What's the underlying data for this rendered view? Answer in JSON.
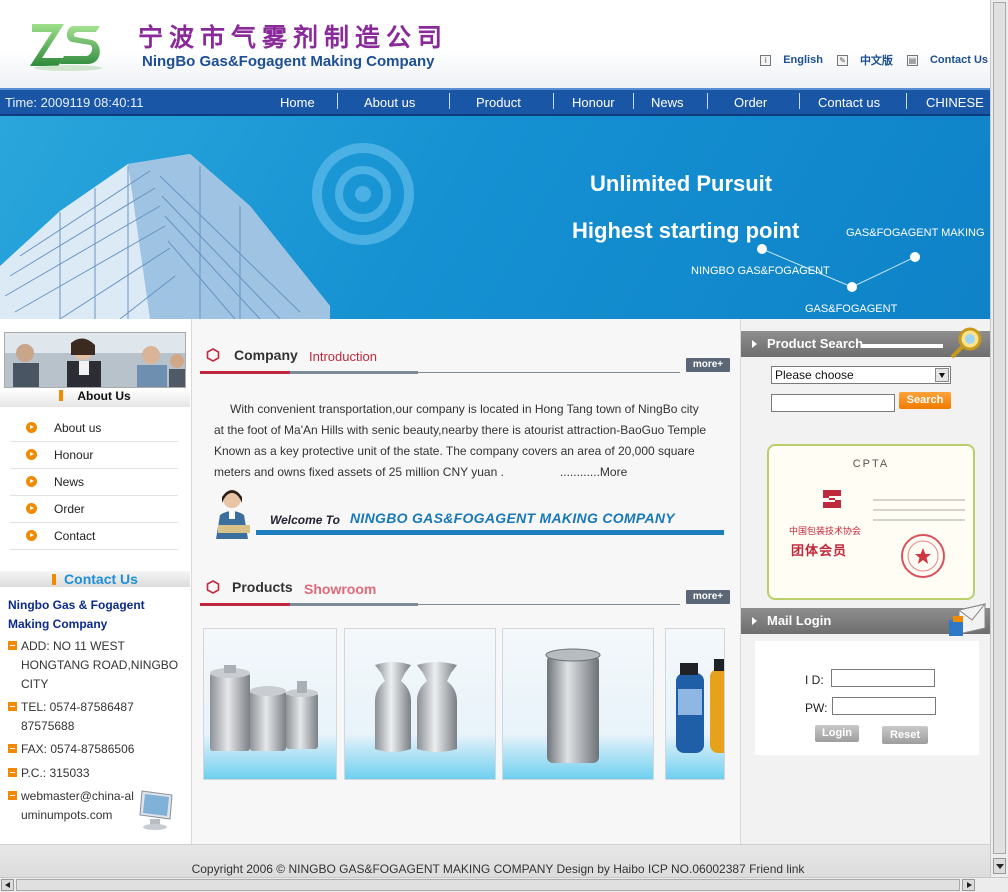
{
  "header": {
    "cn_name": "宁波市气雾剂制造公司",
    "en_name": "NingBo Gas&Fogagent Making Company",
    "links": [
      {
        "label": "English",
        "icon": "info-icon"
      },
      {
        "label": "中文版",
        "icon": "edit-icon"
      },
      {
        "label": "Contact Us",
        "icon": "contact-icon"
      }
    ]
  },
  "nav": {
    "time": "Time: 2009119 08:40:11",
    "items": [
      "Home",
      "About us",
      "Product",
      "Honour",
      "News",
      "Order",
      "Contact us",
      "CHINESE"
    ]
  },
  "banner": {
    "headline1": "Unlimited Pursuit",
    "headline2": "Highest starting point",
    "tags": [
      "GAS&FOGAGENT MAKING",
      "NINGBO GAS&FOGAGENT",
      "GAS&FOGAGENT"
    ]
  },
  "sidebar": {
    "about_title": "About Us",
    "items": [
      "About us",
      "Honour",
      "News",
      "Order",
      "Contact"
    ],
    "contact_title": "Contact Us",
    "company_name": "Ningbo Gas & Fogagent Making Company",
    "info": [
      "ADD: NO 11 WEST HONGTANG ROAD,NINGBO CITY",
      "TEL: 0574-87586487 87575688",
      "FAX: 0574-87586506",
      "P.C.: 315033",
      "webmaster@china-aluminumpots.com"
    ]
  },
  "intro": {
    "title_a": "Company",
    "title_b": "Introduction",
    "more": "more+",
    "text": "With convenient transportation,our company is located in Hong Tang town of NingBo city at the foot of Ma'An Hills with senic beauty,nearby there is atourist attraction-BaoGuo Temple Known as a key protective unit of the state. The company covers an area of 20,000 square meters and owns fixed assets of 25 million CNY yuan .",
    "more_link": "............More",
    "welcome_to": "Welcome To",
    "welcome_name": "NINGBO GAS&FOGAGENT MAKING COMPANY"
  },
  "products": {
    "title_a": "Products",
    "title_b": "Showroom",
    "more": "more+"
  },
  "search": {
    "title": "Product Search",
    "select_value": "Please choose",
    "button": "Search"
  },
  "certificate": {
    "heading": "CPTA",
    "line1": "中国包装技术协会",
    "line2": "团体会员"
  },
  "login": {
    "title": "Mail Login",
    "id_label": "I D:",
    "pw_label": "PW:",
    "login_btn": "Login",
    "reset_btn": "Reset"
  },
  "footer": {
    "text": "Copyright 2006 © NINGBO GAS&FOGAGENT MAKING COMPANY Design by Haibo   ICP NO.06002387 Friend link"
  },
  "colors": {
    "nav_blue": "#1a56a6",
    "accent_orange": "#f08a00",
    "title_red": "#c0283c",
    "contact_blue": "#1e8fd6"
  }
}
